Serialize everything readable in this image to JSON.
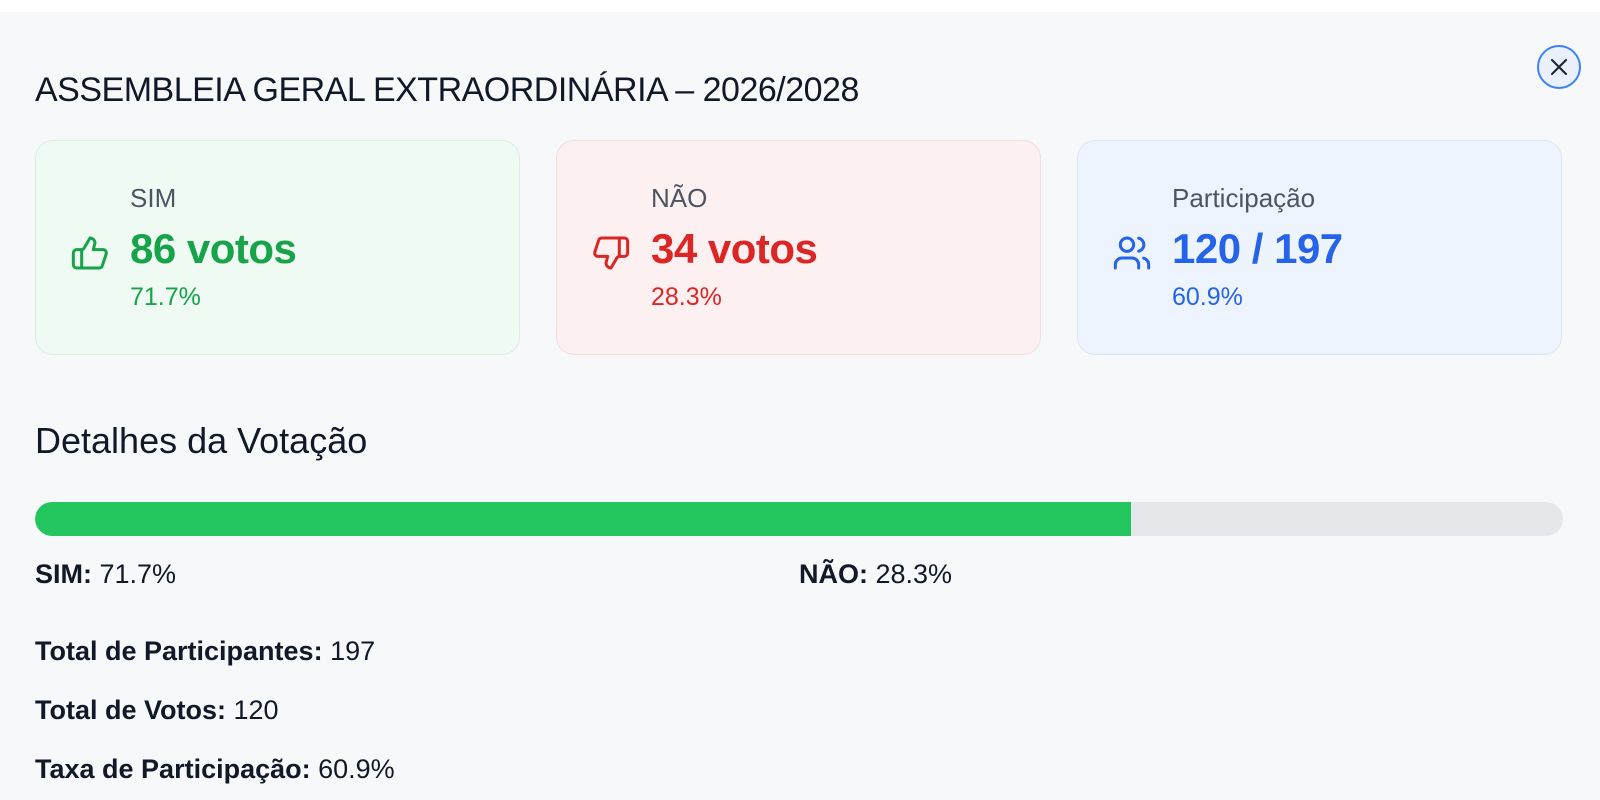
{
  "title": "ASSEMBLEIA GERAL EXTRAORDINÁRIA – 2026/2028",
  "close_icon": "close-icon",
  "cards": {
    "sim": {
      "label": "SIM",
      "value": "86 votos",
      "percent": "71.7%",
      "icon": "thumbs-up-icon",
      "color": "#16a34a"
    },
    "nao": {
      "label": "NÃO",
      "value": "34 votos",
      "percent": "28.3%",
      "icon": "thumbs-down-icon",
      "color": "#dc2626"
    },
    "participacao": {
      "label": "Participação",
      "value": "120 / 197",
      "percent": "60.9%",
      "icon": "users-icon",
      "color": "#2563eb"
    }
  },
  "details": {
    "title": "Detalhes da Votação",
    "progress_sim_fraction": 0.717,
    "legend_sim_label": "SIM:",
    "legend_sim_value": " 71.7%",
    "legend_nao_label": "NÃO:",
    "legend_nao_value": " 28.3%",
    "stats": [
      {
        "label": "Total de Participantes:",
        "value": " 197"
      },
      {
        "label": "Total de Votos:",
        "value": " 120"
      },
      {
        "label": "Taxa de Participação:",
        "value": " 60.9%"
      }
    ]
  }
}
